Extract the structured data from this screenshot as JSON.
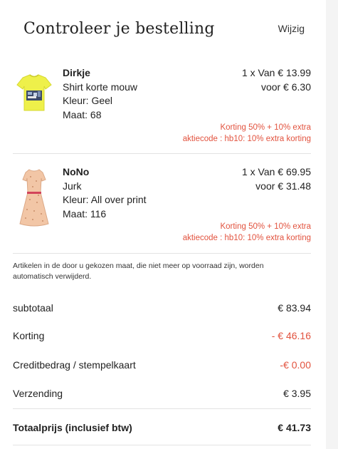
{
  "header": {
    "title": "Controleer je bestelling",
    "edit_label": "Wijzig"
  },
  "items": [
    {
      "name": "Dirkje",
      "type": "Shirt korte mouw",
      "color": "Kleur: Geel",
      "size": "Maat: 68",
      "quantity_price": "1 x Van € 13.99",
      "sale_price": "voor € 6.30",
      "discount": "Korting 50% + 10% extra",
      "promo_code": "aktiecode : hb10: 10% extra korting",
      "image_icon": "yellow-tshirt-icon"
    },
    {
      "name": "NoNo",
      "type": "Jurk",
      "color": "Kleur: All over print",
      "size": "Maat: 116",
      "quantity_price": "1 x Van € 69.95",
      "sale_price": "voor € 31.48",
      "discount": "Korting 50% + 10% extra",
      "promo_code": "aktiecode : hb10: 10% extra korting",
      "image_icon": "dress-icon"
    }
  ],
  "notice": "Artikelen in de door u gekozen maat, die niet meer op voorraad zijn, worden automatisch verwijderd.",
  "summary": {
    "subtotal_label": "subtotaal",
    "subtotal_value": "€ 83.94",
    "discount_label": "Korting",
    "discount_value": "- € 46.16",
    "credit_label": "Creditbedrag / stempelkaart",
    "credit_value": "-€ 0.00",
    "shipping_label": "Verzending",
    "shipping_value": "€ 3.95",
    "total_label": "Totaalprijs (inclusief btw)",
    "total_value": "€ 41.73"
  },
  "colors": {
    "accent_red": "#e2533f",
    "divider": "#e3e3e3"
  }
}
